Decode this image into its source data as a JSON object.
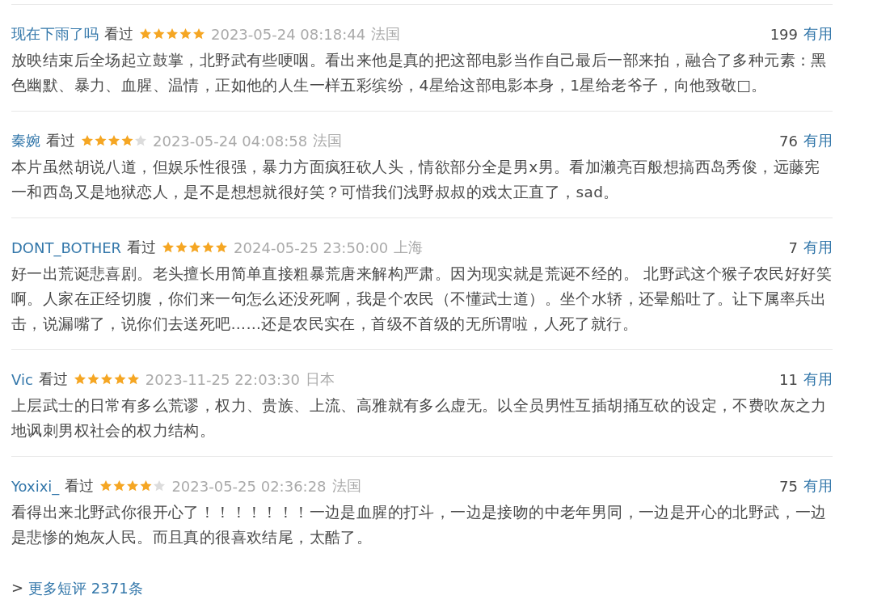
{
  "reviews": [
    {
      "user": "现在下雨了吗",
      "status": "看过",
      "stars": 5,
      "time": "2023-05-24 08:18:44",
      "location": "法国",
      "votes": "199",
      "vote_label": "有用",
      "text": "放映结束后全场起立鼓掌，北野武有些哽咽。看出来他是真的把这部电影当作自己最后一部来拍，融合了多种元素：黑色幽默、暴力、血腥、温情，正如他的人生一样五彩缤纷，4星给这部电影本身，1星给老爷子，向他致敬□。"
    },
    {
      "user": "秦婉",
      "status": "看过",
      "stars": 4,
      "time": "2023-05-24 04:08:58",
      "location": "法国",
      "votes": "76",
      "vote_label": "有用",
      "text": "本片虽然胡说八道，但娱乐性很强，暴力方面疯狂砍人头，情欲部分全是男x男。看加濑亮百般想搞西岛秀俊，远藤宪一和西岛又是地狱恋人，是不是想想就很好笑？可惜我们浅野叔叔的戏太正直了，sad。"
    },
    {
      "user": "DONT_BOTHER",
      "status": "看过",
      "stars": 5,
      "time": "2024-05-25 23:50:00",
      "location": "上海",
      "votes": "7",
      "vote_label": "有用",
      "text": "好一出荒诞悲喜剧。老头擅长用简单直接粗暴荒唐来解构严肃。因为现实就是荒诞不经的。 北野武这个猴子农民好好笑啊。人家在正经切腹，你们来一句怎么还没死啊，我是个农民（不懂武士道）。坐个水轿，还晕船吐了。让下属率兵出击，说漏嘴了，说你们去送死吧……还是农民实在，首级不首级的无所谓啦，人死了就行。"
    },
    {
      "user": "Vic",
      "status": "看过",
      "stars": 5,
      "time": "2023-11-25 22:03:30",
      "location": "日本",
      "votes": "11",
      "vote_label": "有用",
      "text": "上层武士的日常有多么荒谬，权力、贵族、上流、高雅就有多么虚无。以全员男性互插胡捅互砍的设定，不费吹灰之力地讽刺男权社会的权力结构。"
    },
    {
      "user": "Yoxixi_",
      "status": "看过",
      "stars": 4,
      "time": "2023-05-25 02:36:28",
      "location": "法国",
      "votes": "75",
      "vote_label": "有用",
      "text": "看得出来北野武你很开心了！！！！！！！一边是血腥的打斗，一边是接吻的中老年男同，一边是开心的北野武，一边是悲惨的炮灰人民。而且真的很喜欢结尾，太酷了。"
    }
  ],
  "more": {
    "arrow": ">",
    "label": "更多短评 2371条"
  }
}
